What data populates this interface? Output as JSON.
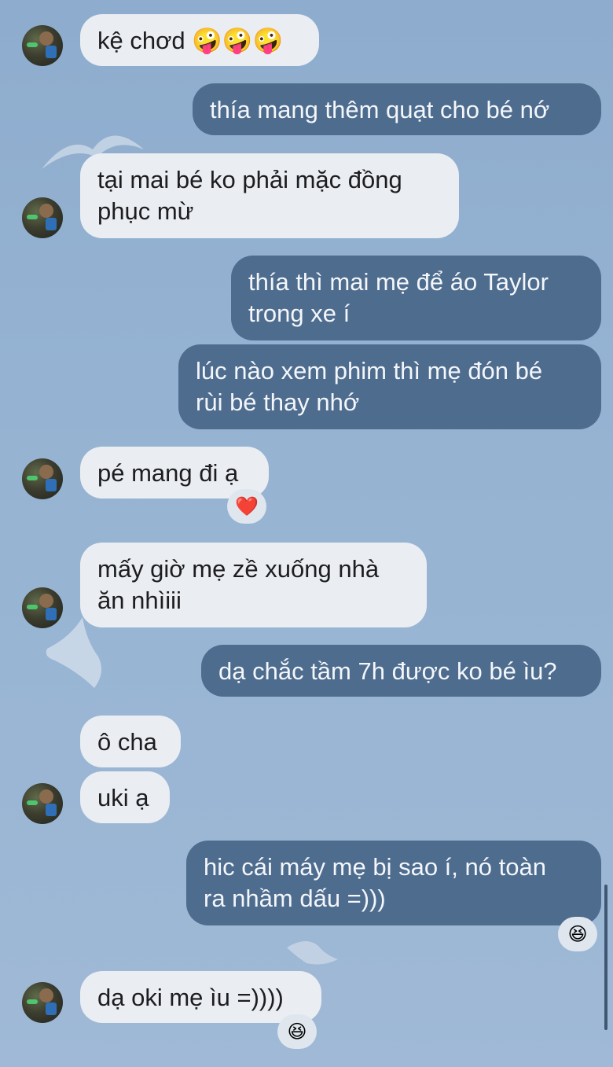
{
  "messages": [
    {
      "dir": "in",
      "lines": [
        "kệ chơd 🤪🤪🤪"
      ]
    },
    {
      "dir": "out",
      "lines": [
        "thía mang thêm quạt cho bé nớ"
      ]
    },
    {
      "dir": "in",
      "lines": [
        "tại mai bé ko phải mặc đồng",
        "phục mừ"
      ]
    },
    {
      "dir": "out",
      "lines": [
        "thía thì mai mẹ để áo Taylor",
        "trong xe í"
      ]
    },
    {
      "dir": "out",
      "lines": [
        "lúc nào xem phim thì mẹ đón bé",
        "rùi bé thay nhớ"
      ]
    },
    {
      "dir": "in",
      "lines": [
        "pé mang đi ạ"
      ],
      "reaction": "❤️"
    },
    {
      "dir": "in",
      "lines": [
        "mấy giờ mẹ zề xuống nhà",
        "ăn nhìiii"
      ]
    },
    {
      "dir": "out",
      "lines": [
        "dạ chắc tầm 7h được ko bé ìu?"
      ]
    },
    {
      "dir": "in",
      "lines": [
        "ô cha"
      ]
    },
    {
      "dir": "in",
      "lines": [
        "uki ạ"
      ]
    },
    {
      "dir": "out",
      "lines": [
        "hic cái máy mẹ bị sao í, nó toàn",
        "ra nhầm dấu =)))"
      ],
      "reaction": "😆"
    },
    {
      "dir": "in",
      "lines": [
        "dạ oki mẹ ìu =))))"
      ],
      "reaction": "😆"
    }
  ],
  "icons": {
    "avatar": "contact-avatar",
    "reaction_heart": "red-heart",
    "reaction_laugh": "grinning-squinting-face"
  },
  "colors": {
    "incoming_bubble": "#eaedf2",
    "outgoing_bubble": "#4e6c8e",
    "background": "#95b2d2"
  }
}
